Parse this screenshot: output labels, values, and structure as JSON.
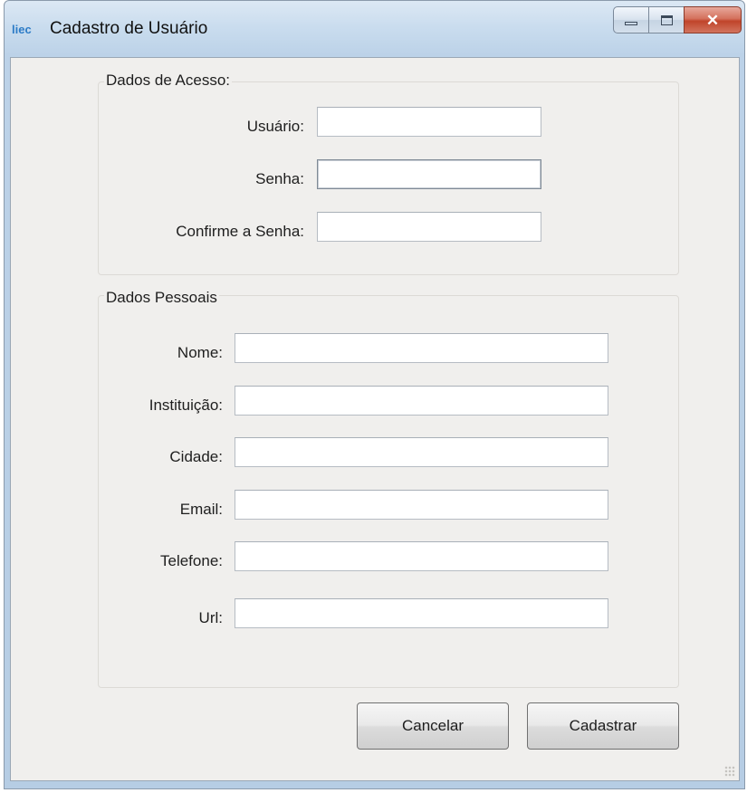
{
  "window": {
    "app_icon_text": "liec",
    "title": "Cadastro de Usuário"
  },
  "access_group": {
    "title": "Dados de Acesso:",
    "fields": [
      {
        "label": "Usuário:",
        "value": ""
      },
      {
        "label": "Senha:",
        "value": ""
      },
      {
        "label": "Confirme a Senha:",
        "value": ""
      }
    ]
  },
  "personal_group": {
    "title": "Dados Pessoais",
    "fields": [
      {
        "label": "Nome:",
        "value": ""
      },
      {
        "label": "Instituição:",
        "value": ""
      },
      {
        "label": "Cidade:",
        "value": ""
      },
      {
        "label": "Email:",
        "value": ""
      },
      {
        "label": "Telefone:",
        "value": ""
      },
      {
        "label": "Url:",
        "value": ""
      }
    ]
  },
  "buttons": {
    "cancel": "Cancelar",
    "submit": "Cadastrar"
  },
  "colors": {
    "form_background": "#f0efed",
    "titlebar": "#c9dcee",
    "close_button": "#c0442a",
    "app_icon": "#2d7cc7"
  }
}
